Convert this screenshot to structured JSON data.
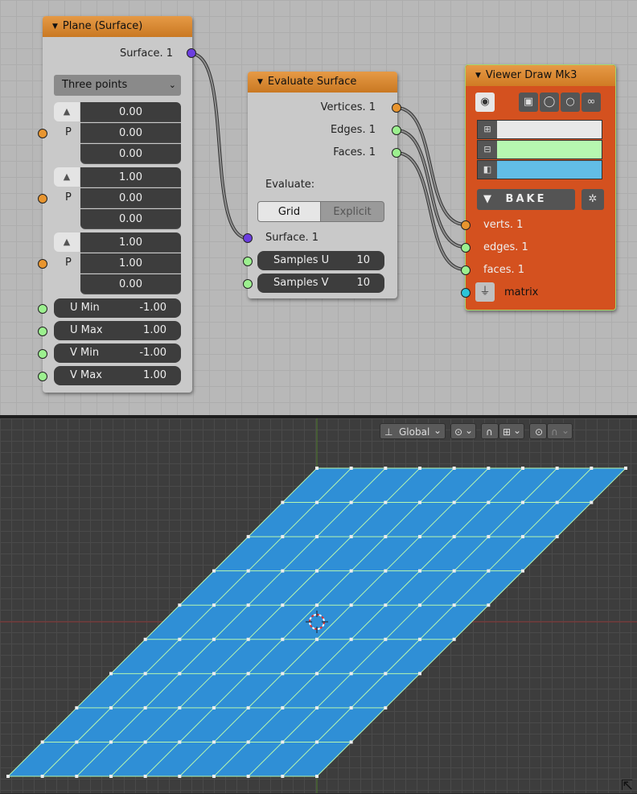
{
  "plane_node": {
    "title": "Plane (Surface)",
    "output_label": "Surface. 1",
    "mode": "Three points",
    "point_label": "P",
    "points": [
      [
        "0.00",
        "0.00",
        "0.00"
      ],
      [
        "1.00",
        "0.00",
        "0.00"
      ],
      [
        "1.00",
        "1.00",
        "0.00"
      ]
    ],
    "params": [
      {
        "label": "U Min",
        "value": "-1.00"
      },
      {
        "label": "U Max",
        "value": "1.00"
      },
      {
        "label": "V Min",
        "value": "-1.00"
      },
      {
        "label": "V Max",
        "value": "1.00"
      }
    ]
  },
  "evaluate_node": {
    "title": "Evaluate Surface",
    "outputs": [
      "Vertices. 1",
      "Edges. 1",
      "Faces. 1"
    ],
    "evaluate_label": "Evaluate:",
    "modes": [
      "Grid",
      "Explicit"
    ],
    "active_mode": "Grid",
    "input_label": "Surface. 1",
    "samples": [
      {
        "label": "Samples U",
        "value": "10"
      },
      {
        "label": "Samples V",
        "value": "10"
      }
    ]
  },
  "viewer_node": {
    "title": "Viewer Draw Mk3",
    "bake_label": "BAKE",
    "colors": {
      "verts": "#e8e8e8",
      "edges": "#b6f7b0",
      "faces": "#62bde6"
    },
    "inputs": [
      "verts. 1",
      "edges. 1",
      "faces. 1",
      "matrix"
    ]
  },
  "viewport": {
    "orientation": "Global",
    "face_color": "#2f8fd6",
    "edge_color": "#b6f7b0"
  },
  "colors": {
    "socket_vertex": "#e8952f",
    "socket_number": "#9cf08f",
    "socket_surface": "#6c3ee0",
    "socket_matrix": "#2bc4d9"
  }
}
